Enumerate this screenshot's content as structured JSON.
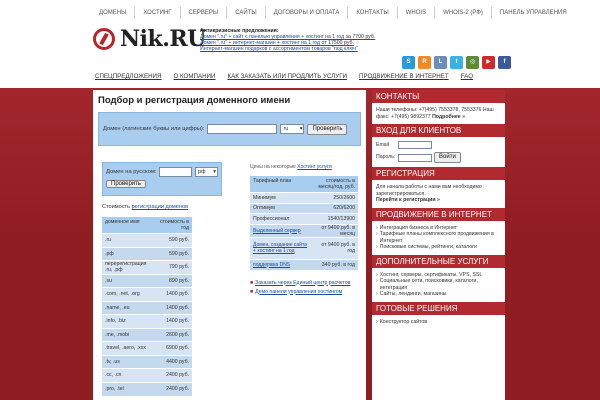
{
  "topnav": [
    "ДОМЕНЫ",
    "ХОСТИНГ",
    "СЕРВЕРЫ",
    "САЙТЫ",
    "ДОГОВОРЫ И ОПЛАТА",
    "КОНТАКТЫ",
    "WHOIS",
    "WHOIS-2 (РФ)",
    "ПАНЕЛЬ УПРАВЛЕНИЯ"
  ],
  "logo": {
    "text": "Nik.RU"
  },
  "promo": {
    "title": "Антикризисные предложения:",
    "items": [
      {
        "link": "Домен \".ru\" + сайт с панелью управления + хостинг на 1 год",
        "note": " за 7700 руб."
      },
      {
        "link": "Домен \".ru\" + интернет-магазин + хостинг на 1 год",
        "note": " от 17500 руб."
      },
      {
        "link": "Интернет-магазин подарков с ассортиментом товаров \"под ключ\"",
        "note": ""
      }
    ]
  },
  "social": [
    {
      "icon": "skype-icon",
      "glyph": "S",
      "color": "#2a9bd8"
    },
    {
      "icon": "rss-icon",
      "glyph": "R",
      "color": "#f08a24"
    },
    {
      "icon": "livejournal-icon",
      "glyph": "L",
      "color": "#6b8fb8"
    },
    {
      "icon": "twitter-icon",
      "glyph": "t",
      "color": "#3ab0e6"
    },
    {
      "icon": "instagram-icon",
      "glyph": "◎",
      "color": "#5d8b3a"
    },
    {
      "icon": "youtube-icon",
      "glyph": "▶",
      "color": "#cc2a2a"
    },
    {
      "icon": "facebook-icon",
      "glyph": "f",
      "color": "#3a5a9a"
    }
  ],
  "mainnav": [
    "СПЕЦПРЕДЛОЖЕНИЯ",
    "О КОМПАНИИ",
    "КАК ЗАКАЗАТЬ ИЛИ ПРОДЛИТЬ УСЛУГИ",
    "ПРОДВИЖЕНИЕ В ИНТЕРНЕТ",
    "FAQ"
  ],
  "main": {
    "title": "Подбор и регистрация доменного имени",
    "latin_label": "Домен (латинские буквы или цифры):",
    "latin_zone": "ru",
    "check_label": "Проверить",
    "rus_label": "Домен на русском:",
    "rus_zone": "рф",
    "check2_label": "Проверить",
    "cost_prefix": "Стоимость ",
    "cost_link": "регистрации доменов",
    "domain_table": {
      "headers": [
        "доменное имя",
        "стоимость в год"
      ],
      "rows": [
        [
          ".ru",
          "590 руб."
        ],
        [
          ".рф",
          "590 руб."
        ],
        [
          "перерегистрация .ru, .рф",
          "790 руб."
        ],
        [
          ".su",
          "890 руб."
        ],
        [
          ".com, .net, .org",
          "1400 руб."
        ],
        [
          ".name, .eu",
          "1400 руб."
        ],
        [
          ".info, .biz",
          "1400 руб."
        ],
        [
          ".me, .mobi",
          "2600 руб."
        ],
        [
          ".travel, .aero, .xxx",
          "6900 руб."
        ],
        [
          ".tv, .us",
          "4400 руб."
        ],
        [
          ".cc, .cn",
          "2400 руб."
        ],
        [
          ".pro, .tel",
          "2400 руб."
        ]
      ]
    },
    "prices_note_prefix": "Цены на некоторые ",
    "prices_note_link": "Хостинг услуги",
    "hosting_table": {
      "headers": [
        "Тарифный план",
        "стоимость в месяц/год, руб."
      ],
      "rows": [
        {
          "name": "Минимум",
          "price": "250/2600",
          "link": false
        },
        {
          "name": "Оптимум",
          "price": "620/6200",
          "link": false
        },
        {
          "name": "Профессионал",
          "price": "1540/13900",
          "link": false
        },
        {
          "name": "Выделенный сервер",
          "price": "от 9400 руб. в месяц",
          "link": true
        },
        {
          "name": "Домен, создание сайта + хостинг на 1 год",
          "price": "от 9400 руб. в год",
          "link": true
        },
        {
          "name": "поддержка DNS",
          "price": "340 руб. в год",
          "link": true
        }
      ]
    },
    "links": [
      "Заказать через Единый центр расчетов",
      "Демо панели управления хостингом"
    ]
  },
  "sidebar": {
    "contacts": {
      "title": "КОНТАКТЫ",
      "text": "Наши телефоны: +7(495) 7553378, 7553376 Наш факс: +7(495) 9892377 ",
      "more": "Подробнее »"
    },
    "login": {
      "title": "ВХОД ДЛЯ КЛИЕНТОВ",
      "email_label": "Email",
      "password_label": "Пароль:",
      "button_label": "Войти"
    },
    "register": {
      "title": "РЕГИСТРАЦИЯ",
      "text": "Для начала работы с нами вам необходимо зарегистрироваться.",
      "link": "Перейти к регистрации »"
    },
    "promo": {
      "title": "ПРОДВИЖЕНИЕ В ИНТЕРНЕТ",
      "items": [
        "Интеграция бизнеса в Интернет",
        "Тарифные планы комплексного продвижения в Интернет",
        "Поисковые системы, рейтинги, каталоги"
      ]
    },
    "extra": {
      "title": "ДОПОЛНИТЕЛЬНЫЕ УСЛУГИ",
      "items": [
        "Хостинг, серверы, сертификаты, VPS, SSL",
        "Социальные сети, поисковики, каталоги, интеграция",
        "Сайты, лендинги, магазины"
      ]
    },
    "ready": {
      "title": "ГОТОВЫЕ РЕШЕНИЯ",
      "items": [
        "Конструктор сайтов"
      ]
    }
  }
}
